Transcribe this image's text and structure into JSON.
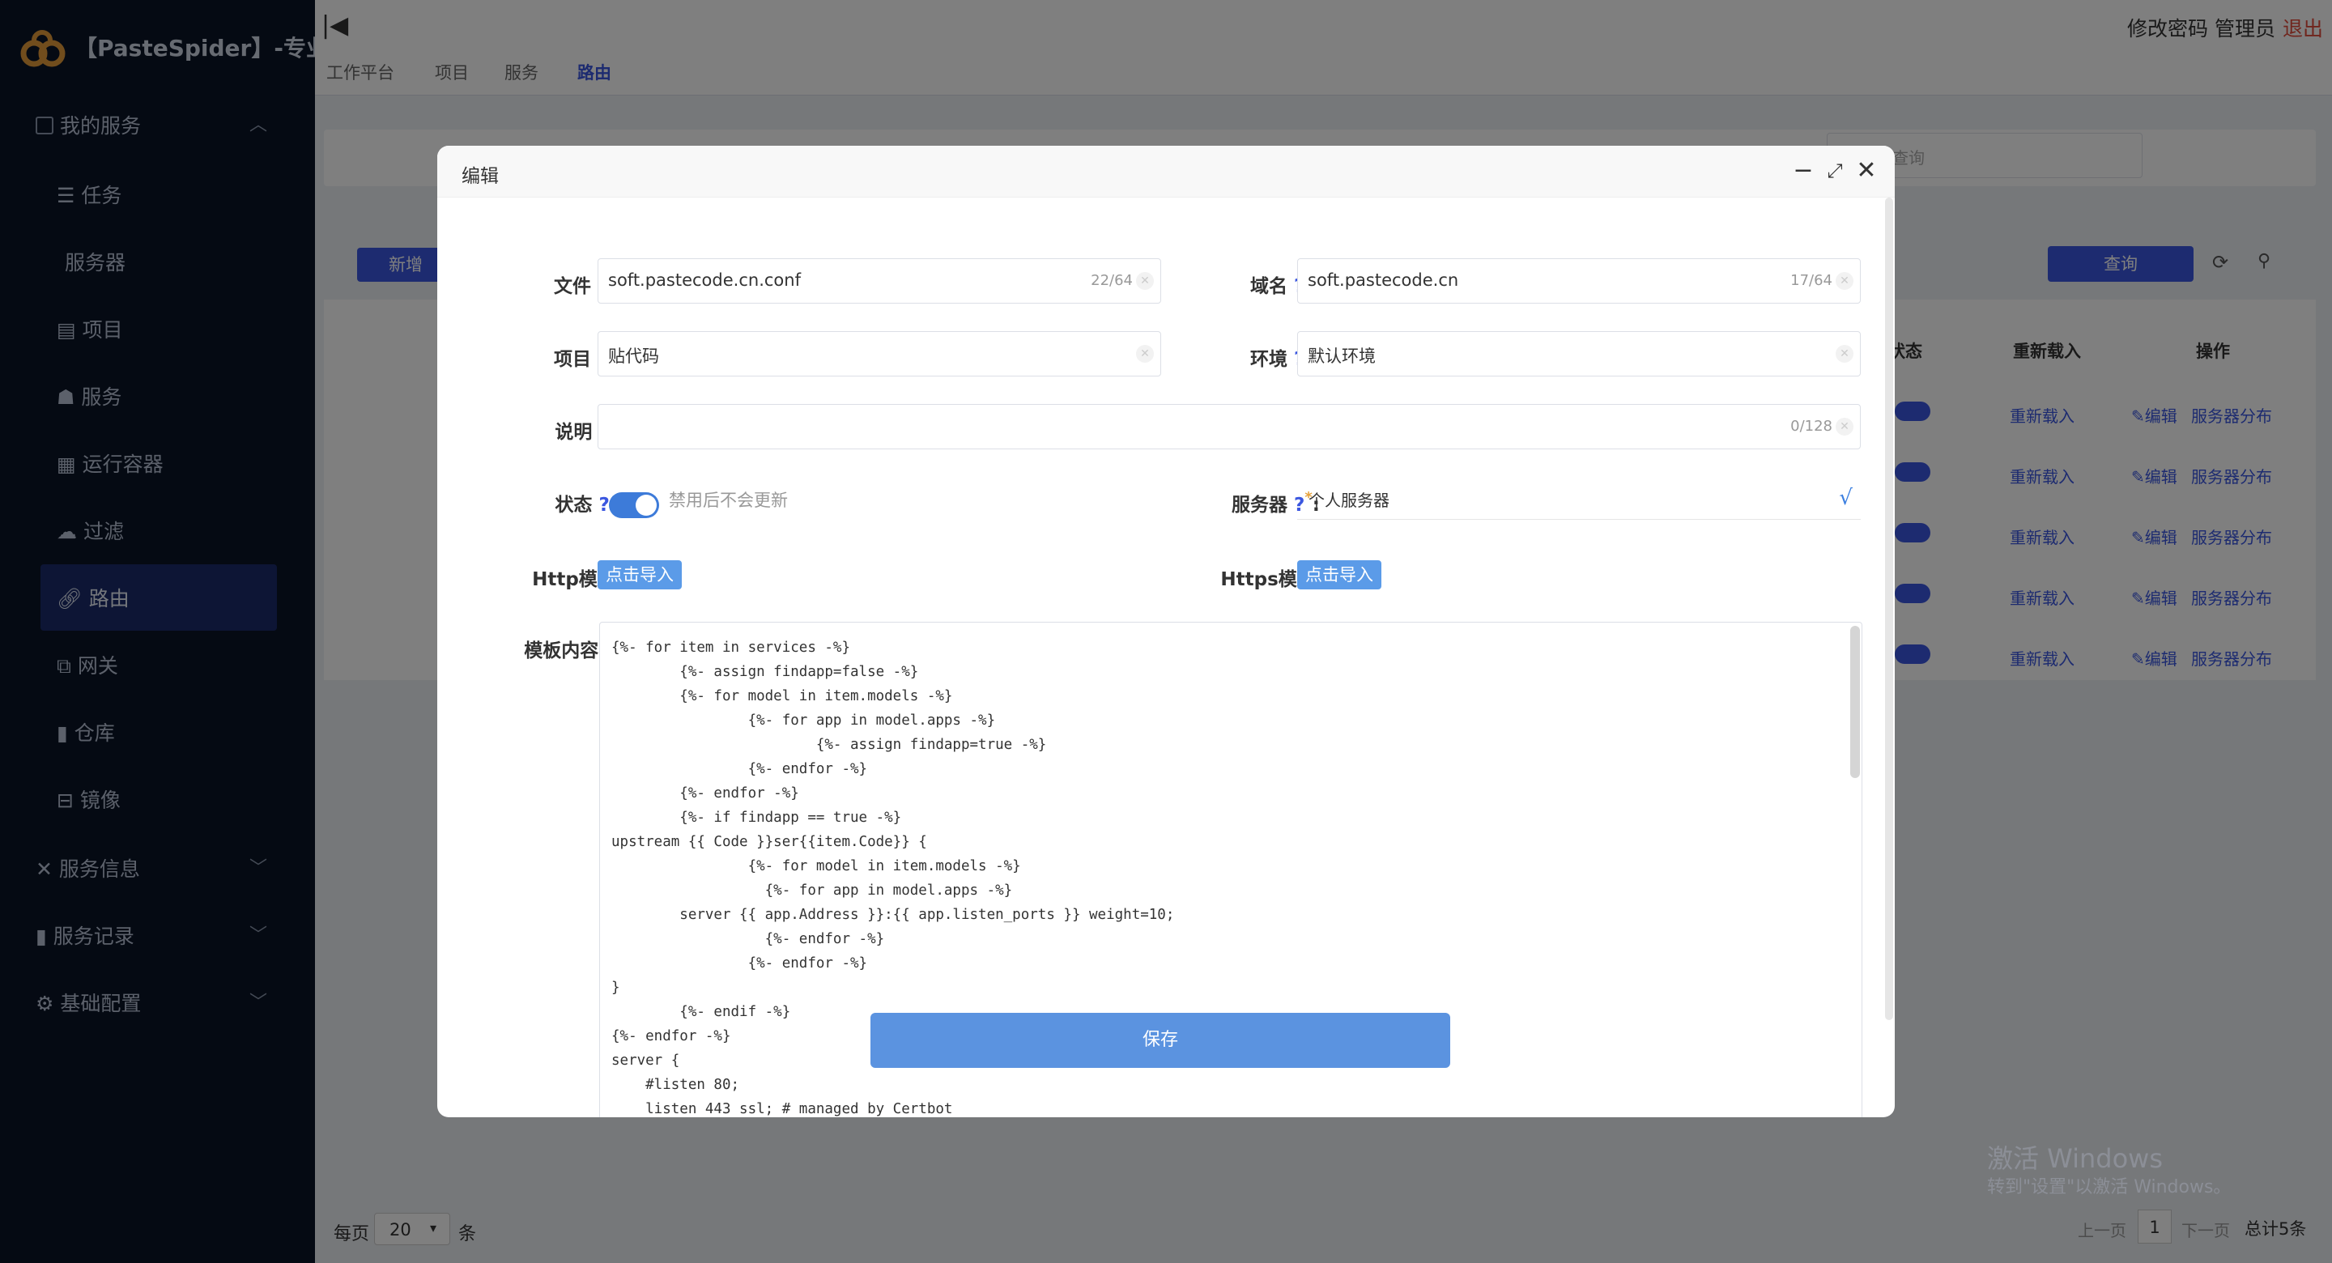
{
  "app": {
    "brand": "【PasteSpider】-专业版",
    "logo_icon": "infinity-cloud-icon"
  },
  "sidebar": {
    "group_my_services": "我的服务",
    "items": [
      {
        "label": "任务",
        "icon": "database-icon"
      },
      {
        "label": "服务器",
        "icon": ""
      },
      {
        "label": "项目",
        "icon": "table-icon"
      },
      {
        "label": "服务",
        "icon": "users-icon"
      },
      {
        "label": "运行容器",
        "icon": "grid-icon"
      },
      {
        "label": "过滤",
        "icon": "cloud-icon"
      },
      {
        "label": "路由",
        "icon": "link-icon"
      },
      {
        "label": "网关",
        "icon": "gateway-icon"
      },
      {
        "label": "仓库",
        "icon": "book-icon"
      },
      {
        "label": "镜像",
        "icon": "briefcase-icon"
      }
    ],
    "active_item": "路由",
    "group_service_info": "服务信息",
    "group_service_records": "服务记录",
    "group_basic_config": "基础配置"
  },
  "header": {
    "nav": [
      "工作平台",
      "项目",
      "服务",
      "路由"
    ],
    "active_nav": "路由",
    "change_password": "修改密码",
    "admin": "管理员",
    "logout": "退出"
  },
  "content": {
    "add_button": "新增",
    "search_placeholder": "查询",
    "query_button": "查询",
    "columns": [
      "状态",
      "重新载入",
      "操作"
    ],
    "rows": [
      {
        "reload": "重新载入",
        "edit": "编辑",
        "dist": "服务器分布"
      },
      {
        "reload": "重新载入",
        "edit": "编辑",
        "dist": "服务器分布"
      },
      {
        "reload": "重新载入",
        "edit": "编辑",
        "dist": "服务器分布"
      },
      {
        "reload": "重新载入",
        "edit": "编辑",
        "dist": "服务器分布"
      },
      {
        "reload": "重新载入",
        "edit": "编辑",
        "dist": "服务器分布"
      }
    ],
    "per_page_label": "每页",
    "per_page_value": "20",
    "per_page_unit": "条",
    "prev": "上一页",
    "page": "1",
    "next": "下一页",
    "total": "总计5条"
  },
  "modal": {
    "title": "编辑",
    "fields": {
      "file_label": "文件",
      "file_value": "soft.pastecode.cn.conf",
      "file_count": "22/64",
      "domain_label": "域名",
      "domain_value": "soft.pastecode.cn",
      "domain_count": "17/64",
      "project_label": "项目",
      "project_value": "贴代码",
      "env_label": "环境",
      "env_value": "默认环境",
      "desc_label": "说明",
      "desc_value": "",
      "desc_count": "0/128",
      "status_label": "状态",
      "status_hint": "禁用后不会更新",
      "server_label": "服务器",
      "server_value": "个人服务器",
      "server_check": "√",
      "http_label": "Http模板:",
      "https_label": "Https模板:",
      "import_label": "点击导入",
      "template_label": "模板内容"
    },
    "qmark": "?",
    "colon": ":",
    "template_content": "{%- for item in services -%}\n        {%- assign findapp=false -%}\n        {%- for model in item.models -%}\n                {%- for app in model.apps -%}\n                        {%- assign findapp=true -%}\n                {%- endfor -%}\n        {%- endfor -%}\n        {%- if findapp == true -%}\nupstream {{ Code }}ser{{item.Code}} {\n                {%- for model in item.models -%}\n                  {%- for app in model.apps -%}\n        server {{ app.Address }}:{{ app.listen_ports }} weight=10;\n                  {%- endfor -%}\n                {%- endfor -%}\n}\n        {%- endif -%}\n{%- endfor -%}\nserver {\n    #listen 80;\n    listen 443 ssl; # managed by Certbot",
    "save_button": "保存"
  },
  "watermark": {
    "line1": "激活 Windows",
    "line2": "转到\"设置\"以激活 Windows。"
  },
  "colors": {
    "sidebar": "#0b1426",
    "accent": "#3b57e0",
    "switch": "#3d7bd9",
    "save": "#5b93e0"
  }
}
